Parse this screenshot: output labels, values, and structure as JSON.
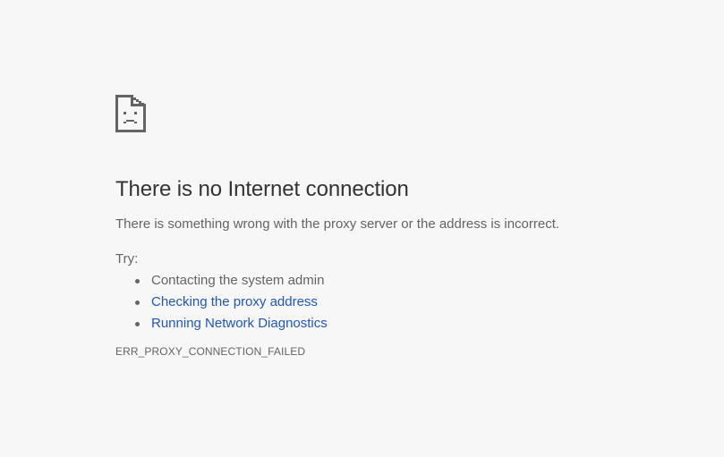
{
  "page": {
    "icon": "sad-document-icon",
    "title": "There is no Internet connection",
    "description": "There is something wrong with the proxy server or the address is incorrect.",
    "try_label": "Try:",
    "suggestions": [
      {
        "text": "Contacting the system admin",
        "is_link": false
      },
      {
        "text": "Checking the proxy address",
        "is_link": true
      },
      {
        "text": "Running Network Diagnostics",
        "is_link": true
      }
    ],
    "error_code": "ERR_PROXY_CONNECTION_FAILED"
  },
  "colors": {
    "background": "#f7f7f7",
    "title": "#333333",
    "body_text": "#646464",
    "link": "#2155c0"
  }
}
